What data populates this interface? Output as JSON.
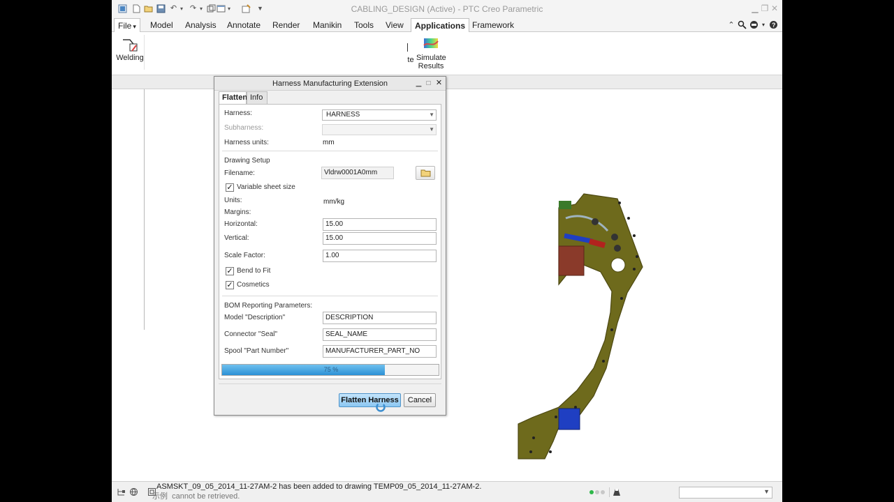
{
  "app": {
    "title": "CABLING_DESIGN (Active) - PTC Creo Parametric"
  },
  "menubar": {
    "items": [
      {
        "label": "File",
        "active": false
      },
      {
        "label": "Model",
        "active": false
      },
      {
        "label": "Analysis",
        "active": false
      },
      {
        "label": "Annotate",
        "active": false
      },
      {
        "label": "Render",
        "active": false
      },
      {
        "label": "Manikin",
        "active": false
      },
      {
        "label": "Tools",
        "active": false
      },
      {
        "label": "View",
        "active": false
      },
      {
        "label": "Applications",
        "active": true
      },
      {
        "label": "Framework",
        "active": false
      }
    ],
    "file_arrow": "▾"
  },
  "ribbon": {
    "welding_label": "Welding",
    "partial_label": "te",
    "simulate_line1": "Simulate",
    "simulate_line2": "Results"
  },
  "dialog": {
    "title": "Harness Manufacturing Extension",
    "tabs": [
      "Flatten",
      "Info"
    ],
    "harness_label": "Harness:",
    "harness_value": "HARNESS",
    "subharness_label": "Subharness:",
    "subharness_value": "",
    "units_label": "Harness units:",
    "units_value": "mm",
    "drawing_setup_label": "Drawing Setup",
    "filename_label": "Filename:",
    "filename_value": "Vldrw0001A0mm",
    "variable_sheet_label": "Variable sheet size",
    "variable_sheet_checked": true,
    "units2_label": "Units:",
    "units2_value": "mm/kg",
    "margins_label": "Margins:",
    "horizontal_label": "Horizontal:",
    "horizontal_value": "15.00",
    "vertical_label": "Vertical:",
    "vertical_value": "15.00",
    "scale_label": "Scale Factor:",
    "scale_value": "1.00",
    "bend_label": "Bend to Fit",
    "bend_checked": true,
    "cosmetics_label": "Cosmetics",
    "cosmetics_checked": true,
    "bom_label": "BOM Reporting Parameters:",
    "model_desc_label": "Model \"Description\"",
    "model_desc_value": "DESCRIPTION",
    "connector_seal_label": "Connector \"Seal\"",
    "connector_seal_value": "SEAL_NAME",
    "spool_label": "Spool \"Part Number\"",
    "spool_value": "MANUFACTURER_PART_NO",
    "progress": 0.75,
    "progress_text": "75 %",
    "flatten_button": "Flatten Harness",
    "cancel_button": "Cancel"
  },
  "status": {
    "message": "ASMSKT_09_05_2014_11-27AM-2 has been added to drawing TEMP09_05_2014_11-27AM-2.",
    "message2": "cannot be retrieved.",
    "message2_prefix": "示例"
  },
  "colors": {
    "part_olive": "#6e6a1c",
    "part_olive_dark": "#4c4812",
    "accent_blue": "#2c91d6"
  }
}
